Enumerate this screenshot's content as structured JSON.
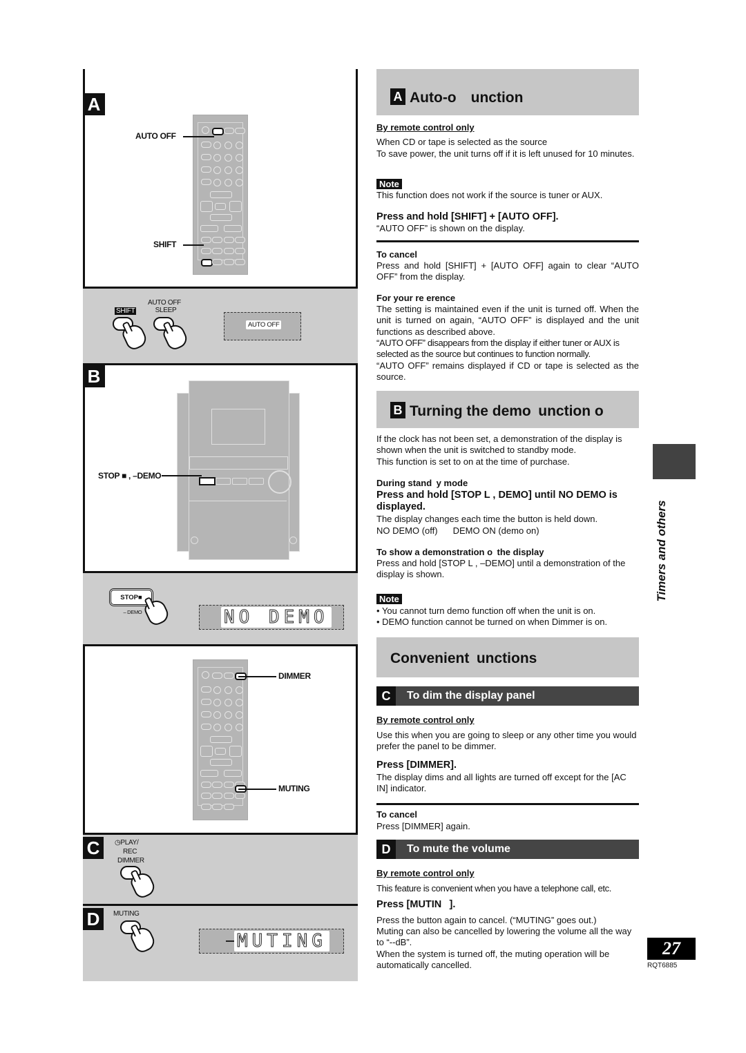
{
  "illustrations": {
    "panel_a": {
      "letter": "A",
      "callouts": [
        "AUTO OFF",
        "SHIFT"
      ],
      "step": {
        "shift_label": "SHIFT",
        "auto_off_label_1": "AUTO OFF",
        "auto_off_label_2": "SLEEP",
        "display_text": "AUTO OFF"
      }
    },
    "panel_b": {
      "letter": "B",
      "callout": "STOP ■ , –DEMO",
      "step": {
        "button_label": "STOP■",
        "button_sublabel": "– DEMO",
        "display_text": "NO DEMO"
      }
    },
    "panel_cd": {
      "callouts": [
        "DIMMER",
        "MUTING"
      ]
    },
    "panel_c": {
      "letter": "C",
      "label_1": "◷PLAY/",
      "label_2": "REC",
      "label_3": "DIMMER"
    },
    "panel_d": {
      "letter": "D",
      "label": "MUTING",
      "display_text": "MUTING"
    }
  },
  "section_a": {
    "letter": "A",
    "title": "Auto-o  unction",
    "remote_only": "By remote control only",
    "intro_1": "When CD or tape is selected as the source",
    "intro_2": "To save power, the unit turns off if it is left unused for 10 minutes.",
    "note_label": "Note",
    "note": "This function does not work if the source is tuner or AUX.",
    "instruction": "Press and hold [SHIFT] + [AUTO OFF].",
    "instruction_result": "“AUTO OFF” is shown on the display.",
    "cancel_heading": "To cancel",
    "cancel_text": "Press and hold [SHIFT] + [AUTO OFF] again to clear “AUTO OFF” from the display.",
    "reference_heading": "For your re erence",
    "reference_1": "The setting is maintained even if the unit is turned off. When the unit is turned on again, “AUTO OFF” is displayed and the unit functions as described above.",
    "reference_2": "“AUTO OFF” disappears from the display if either tuner or AUX is selected as the source but continues to function normally.",
    "reference_3": "“AUTO OFF” remains displayed if CD or tape is selected as the source."
  },
  "section_b": {
    "letter": "B",
    "title": "Turning the demo unction o",
    "intro_1": "If the clock has not been set, a demonstration of the display is shown when the unit is switched to standby mode.",
    "intro_2": "This function is set to on at the time of purchase.",
    "standby_heading": "During stand y mode",
    "instruction": "Press and hold [STOP L , DEMO] until NO DEMO is displayed.",
    "instruction_result": "The display changes each time the button is held down.",
    "toggle_off": "NO DEMO (off)",
    "toggle_on": "DEMO ON (demo on)",
    "show_heading": "To show a demonstration o the display",
    "show_text": "Press and hold [STOP L , –DEMO] until a demonstration of the display is shown.",
    "note_label": "Note",
    "notes": [
      "You cannot turn demo function off when the unit is on.",
      "DEMO function cannot be turned on when Dimmer is on."
    ]
  },
  "section_convenient": {
    "title": "Convenient unctions"
  },
  "section_c": {
    "letter": "C",
    "title": "To dim the display panel",
    "remote_only": "By remote control only",
    "intro": "Use this when you are going to sleep or any other time you would prefer the panel to be dimmer.",
    "instruction": "Press [DIMMER].",
    "instruction_result": "The display dims and all lights are turned off except for the [AC IN] indicator.",
    "cancel_heading": "To cancel",
    "cancel_text": "Press [DIMMER] again."
  },
  "section_d": {
    "letter": "D",
    "title": "To mute the volume",
    "remote_only": "By remote control only",
    "intro": "This feature is convenient when you have a telephone call, etc.",
    "instruction": "Press [MUTIN  ].",
    "result_1": "Press the button again to cancel. (“MUTING” goes out.)",
    "result_2": "Muting can also be cancelled by lowering the volume all the way to “--dB”.",
    "result_3": "When the system is turned off, the muting operation will be automatically cancelled."
  },
  "sidebar": {
    "chapter_label": "Timers and others",
    "page_number": "27",
    "doc_code": "RQT6885"
  }
}
